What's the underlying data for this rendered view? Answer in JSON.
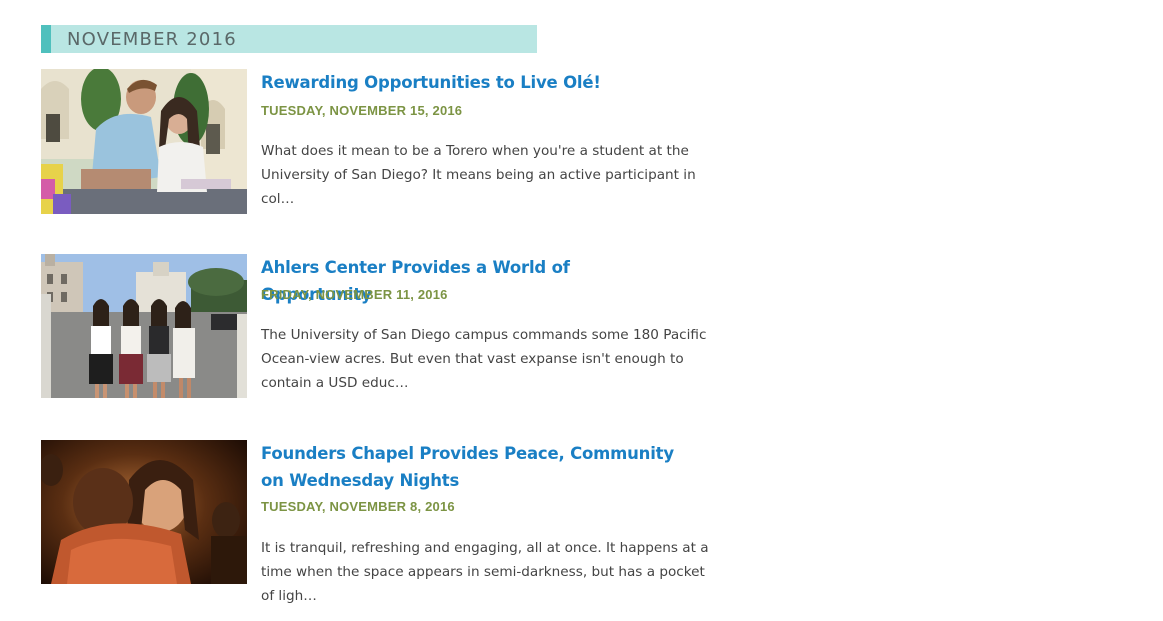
{
  "section": {
    "month_label": "NOVEMBER 2016",
    "accent_color": "#4fc0bd",
    "band_color": "#b9e6e3"
  },
  "articles": [
    {
      "title": "Rewarding Opportunities to Live Olé!",
      "date": "TUESDAY, NOVEMBER 15, 2016",
      "excerpt": "What does it mean to be a Torero when you're a student at the University of San Diego? It means being an active participant in col…",
      "image": "students-courtyard-photo"
    },
    {
      "title": "Ahlers Center Provides a World of Opportunity",
      "date": "FRIDAY, NOVEMBER 11, 2016",
      "excerpt": "The University of San Diego campus commands some 180 Pacific Ocean-view acres. But even that vast expanse isn't enough to contain a USD educ…",
      "image": "students-abroad-plaza-photo"
    },
    {
      "title": "Founders Chapel Provides Peace, Community on Wednesday Nights",
      "date": "TUESDAY, NOVEMBER 8, 2016",
      "excerpt": "It is tranquil, refreshing and engaging, all at once. It happens at a time when the space appears in semi-darkness, but has a pocket of ligh…",
      "image": "chapel-embrace-photo"
    }
  ],
  "colors": {
    "title": "#1a7fc4",
    "date": "#7c9444",
    "excerpt": "#444444"
  }
}
